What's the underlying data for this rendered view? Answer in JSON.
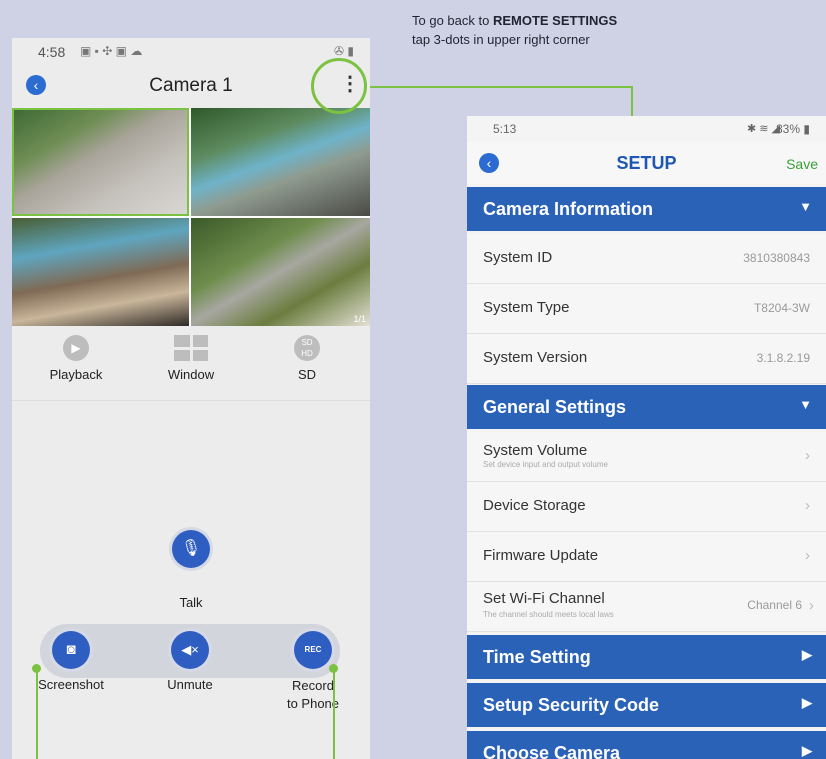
{
  "annotation": {
    "line1_prefix": "To go back to ",
    "line1_bold": "REMOTE SETTINGS",
    "line2": "tap 3-dots in upper right corner"
  },
  "left_phone": {
    "status_time": "4:58",
    "title": "Camera 1",
    "page_indicator": "1/1",
    "controls": [
      {
        "label": "Playback",
        "icon": "play-icon"
      },
      {
        "label": "Window",
        "icon": "grid-icon"
      },
      {
        "label": "SD",
        "icon": "sd-hd-icon"
      }
    ],
    "talk_label": "Talk",
    "tools": [
      {
        "label": "Screenshot",
        "icon": "camera-icon"
      },
      {
        "label": "Unmute",
        "icon": "speaker-mute-icon"
      },
      {
        "label": "Record\nto Phone",
        "icon": "rec-icon",
        "glyph": "REC"
      }
    ]
  },
  "right_phone": {
    "status_time": "5:13",
    "status_battery": "83%",
    "title": "SETUP",
    "save_label": "Save",
    "camera_information": {
      "header": "Camera Information",
      "rows": [
        {
          "label": "System ID",
          "value": "3810380843"
        },
        {
          "label": "System Type",
          "value": "T8204-3W"
        },
        {
          "label": "System Version",
          "value": "3.1.8.2.19"
        }
      ]
    },
    "general_settings": {
      "header": "General Settings",
      "rows": [
        {
          "label": "System Volume",
          "sub": "Set device input and output volume"
        },
        {
          "label": "Device Storage"
        },
        {
          "label": "Firmware Update"
        },
        {
          "label": "Set Wi-Fi Channel",
          "sub": "The channel should meets local laws",
          "value": "Channel 6"
        }
      ]
    },
    "sections": [
      {
        "header": "Time Setting"
      },
      {
        "header": "Setup Security Code"
      },
      {
        "header": "Choose Camera"
      }
    ]
  },
  "colors": {
    "accent_blue": "#2a62b8",
    "annotation_green": "#7cc242",
    "save_green": "#3aa13a"
  }
}
